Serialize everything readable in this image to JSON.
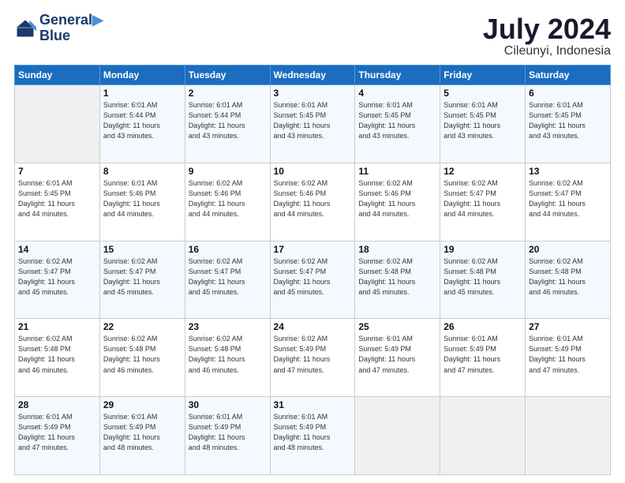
{
  "header": {
    "logo": {
      "line1": "General",
      "line2": "Blue"
    },
    "title": "July 2024",
    "subtitle": "Cileunyi, Indonesia"
  },
  "weekdays": [
    "Sunday",
    "Monday",
    "Tuesday",
    "Wednesday",
    "Thursday",
    "Friday",
    "Saturday"
  ],
  "weeks": [
    [
      {
        "day": "",
        "empty": true
      },
      {
        "day": "1",
        "sunrise": "6:01 AM",
        "sunset": "5:44 PM",
        "daylight": "11 hours and 43 minutes."
      },
      {
        "day": "2",
        "sunrise": "6:01 AM",
        "sunset": "5:44 PM",
        "daylight": "11 hours and 43 minutes."
      },
      {
        "day": "3",
        "sunrise": "6:01 AM",
        "sunset": "5:45 PM",
        "daylight": "11 hours and 43 minutes."
      },
      {
        "day": "4",
        "sunrise": "6:01 AM",
        "sunset": "5:45 PM",
        "daylight": "11 hours and 43 minutes."
      },
      {
        "day": "5",
        "sunrise": "6:01 AM",
        "sunset": "5:45 PM",
        "daylight": "11 hours and 43 minutes."
      },
      {
        "day": "6",
        "sunrise": "6:01 AM",
        "sunset": "5:45 PM",
        "daylight": "11 hours and 43 minutes."
      }
    ],
    [
      {
        "day": "7",
        "sunrise": "6:01 AM",
        "sunset": "5:45 PM",
        "daylight": "11 hours and 44 minutes."
      },
      {
        "day": "8",
        "sunrise": "6:01 AM",
        "sunset": "5:46 PM",
        "daylight": "11 hours and 44 minutes."
      },
      {
        "day": "9",
        "sunrise": "6:02 AM",
        "sunset": "5:46 PM",
        "daylight": "11 hours and 44 minutes."
      },
      {
        "day": "10",
        "sunrise": "6:02 AM",
        "sunset": "5:46 PM",
        "daylight": "11 hours and 44 minutes."
      },
      {
        "day": "11",
        "sunrise": "6:02 AM",
        "sunset": "5:46 PM",
        "daylight": "11 hours and 44 minutes."
      },
      {
        "day": "12",
        "sunrise": "6:02 AM",
        "sunset": "5:47 PM",
        "daylight": "11 hours and 44 minutes."
      },
      {
        "day": "13",
        "sunrise": "6:02 AM",
        "sunset": "5:47 PM",
        "daylight": "11 hours and 44 minutes."
      }
    ],
    [
      {
        "day": "14",
        "sunrise": "6:02 AM",
        "sunset": "5:47 PM",
        "daylight": "11 hours and 45 minutes."
      },
      {
        "day": "15",
        "sunrise": "6:02 AM",
        "sunset": "5:47 PM",
        "daylight": "11 hours and 45 minutes."
      },
      {
        "day": "16",
        "sunrise": "6:02 AM",
        "sunset": "5:47 PM",
        "daylight": "11 hours and 45 minutes."
      },
      {
        "day": "17",
        "sunrise": "6:02 AM",
        "sunset": "5:47 PM",
        "daylight": "11 hours and 45 minutes."
      },
      {
        "day": "18",
        "sunrise": "6:02 AM",
        "sunset": "5:48 PM",
        "daylight": "11 hours and 45 minutes."
      },
      {
        "day": "19",
        "sunrise": "6:02 AM",
        "sunset": "5:48 PM",
        "daylight": "11 hours and 45 minutes."
      },
      {
        "day": "20",
        "sunrise": "6:02 AM",
        "sunset": "5:48 PM",
        "daylight": "11 hours and 46 minutes."
      }
    ],
    [
      {
        "day": "21",
        "sunrise": "6:02 AM",
        "sunset": "5:48 PM",
        "daylight": "11 hours and 46 minutes."
      },
      {
        "day": "22",
        "sunrise": "6:02 AM",
        "sunset": "5:48 PM",
        "daylight": "11 hours and 46 minutes."
      },
      {
        "day": "23",
        "sunrise": "6:02 AM",
        "sunset": "5:48 PM",
        "daylight": "11 hours and 46 minutes."
      },
      {
        "day": "24",
        "sunrise": "6:02 AM",
        "sunset": "5:49 PM",
        "daylight": "11 hours and 47 minutes."
      },
      {
        "day": "25",
        "sunrise": "6:01 AM",
        "sunset": "5:49 PM",
        "daylight": "11 hours and 47 minutes."
      },
      {
        "day": "26",
        "sunrise": "6:01 AM",
        "sunset": "5:49 PM",
        "daylight": "11 hours and 47 minutes."
      },
      {
        "day": "27",
        "sunrise": "6:01 AM",
        "sunset": "5:49 PM",
        "daylight": "11 hours and 47 minutes."
      }
    ],
    [
      {
        "day": "28",
        "sunrise": "6:01 AM",
        "sunset": "5:49 PM",
        "daylight": "11 hours and 47 minutes."
      },
      {
        "day": "29",
        "sunrise": "6:01 AM",
        "sunset": "5:49 PM",
        "daylight": "11 hours and 48 minutes."
      },
      {
        "day": "30",
        "sunrise": "6:01 AM",
        "sunset": "5:49 PM",
        "daylight": "11 hours and 48 minutes."
      },
      {
        "day": "31",
        "sunrise": "6:01 AM",
        "sunset": "5:49 PM",
        "daylight": "11 hours and 48 minutes."
      },
      {
        "day": "",
        "empty": true
      },
      {
        "day": "",
        "empty": true
      },
      {
        "day": "",
        "empty": true
      }
    ]
  ],
  "labels": {
    "sunrise": "Sunrise:",
    "sunset": "Sunset:",
    "daylight": "Daylight:"
  }
}
